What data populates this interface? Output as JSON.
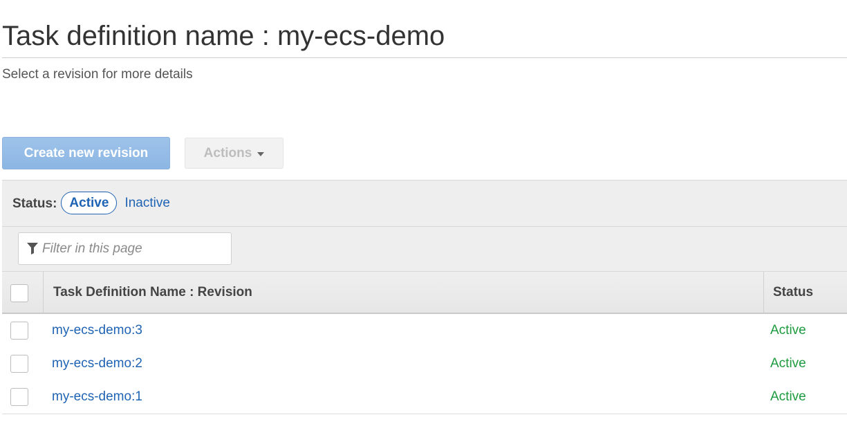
{
  "page": {
    "title": "Task definition name : my-ecs-demo",
    "subtitle": "Select a revision for more details"
  },
  "toolbar": {
    "create_label": "Create new revision",
    "actions_label": "Actions"
  },
  "status_filter": {
    "label": "Status:",
    "active": "Active",
    "inactive": "Inactive"
  },
  "filter": {
    "placeholder": "Filter in this page",
    "value": ""
  },
  "table": {
    "columns": [
      "Task Definition Name : Revision",
      "Status"
    ],
    "rows": [
      {
        "name": "my-ecs-demo:3",
        "status": "Active"
      },
      {
        "name": "my-ecs-demo:2",
        "status": "Active"
      },
      {
        "name": "my-ecs-demo:1",
        "status": "Active"
      }
    ]
  },
  "colors": {
    "link": "#1f63b4",
    "status_active": "#1c9a3d",
    "primary_button": "#8cb6e3",
    "panel_bg": "#eeeeee"
  },
  "icons": {
    "filter": "filter-funnel-icon",
    "actions_caret": "caret-down-icon"
  }
}
